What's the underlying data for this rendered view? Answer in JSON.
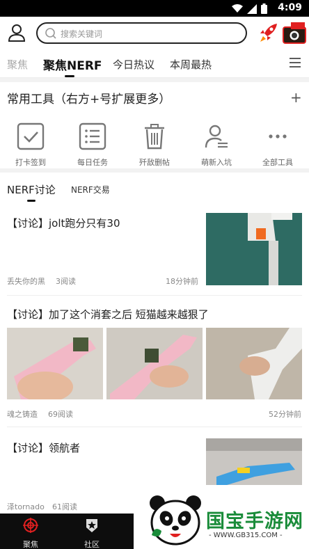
{
  "status_bar": {
    "time": "4:09"
  },
  "header": {
    "search_placeholder": "搜索关键词"
  },
  "tabs": [
    {
      "label": "聚焦"
    },
    {
      "label": "聚焦NERF"
    },
    {
      "label": "今日热议"
    },
    {
      "label": "本周最热"
    }
  ],
  "tools": {
    "title": "常用工具（右方+号扩展更多）",
    "items": [
      {
        "label": "打卡签到",
        "icon": "checkin-icon"
      },
      {
        "label": "每日任务",
        "icon": "task-list-icon"
      },
      {
        "label": "歼敌删帖",
        "icon": "trash-icon"
      },
      {
        "label": "萌新入坑",
        "icon": "newbie-user-icon"
      },
      {
        "label": "全部工具",
        "icon": "more-dots-icon"
      }
    ]
  },
  "subtabs": [
    {
      "label": "NERF讨论"
    },
    {
      "label": "NERF交易"
    }
  ],
  "posts": [
    {
      "title": "【讨论】jolt跑分只有30",
      "author": "丢失你的黑",
      "reads": "3阅读",
      "time": "18分钟前"
    },
    {
      "title": "【讨论】加了这个消套之后 短猫越来越狠了",
      "author": "魂之铸造",
      "reads": "69阅读",
      "time": "52分钟前"
    },
    {
      "title": "【讨论】领航者",
      "author": "泽tornado",
      "reads": "61阅读",
      "time": ""
    }
  ],
  "bottom_nav": [
    {
      "label": "聚焦"
    },
    {
      "label": "社区"
    }
  ],
  "watermark": {
    "text": "国宝手游网",
    "url": "- WWW.GB315.COM -"
  },
  "colors": {
    "accent": "#e02020",
    "watermark_green": "#1a8c3a"
  }
}
